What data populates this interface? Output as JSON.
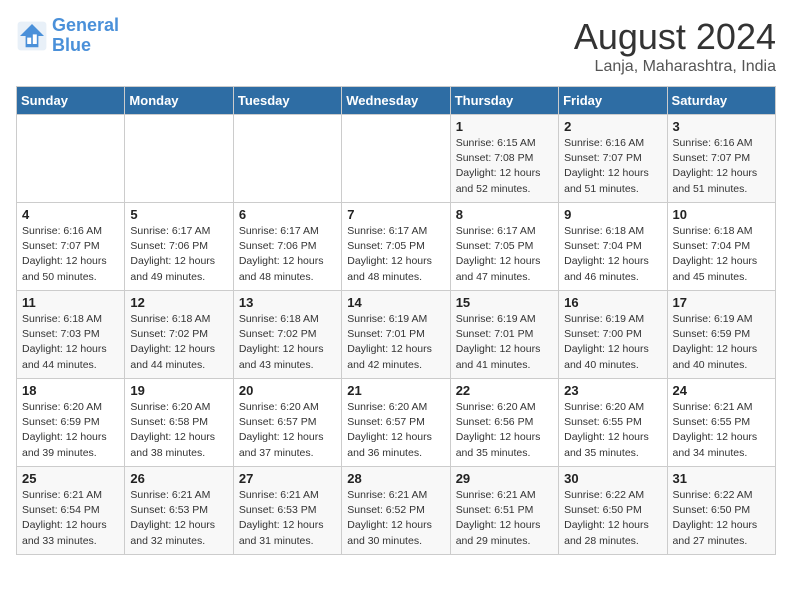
{
  "logo": {
    "line1": "General",
    "line2": "Blue"
  },
  "title": "August 2024",
  "subtitle": "Lanja, Maharashtra, India",
  "days_of_week": [
    "Sunday",
    "Monday",
    "Tuesday",
    "Wednesday",
    "Thursday",
    "Friday",
    "Saturday"
  ],
  "weeks": [
    [
      {
        "day": "",
        "info": ""
      },
      {
        "day": "",
        "info": ""
      },
      {
        "day": "",
        "info": ""
      },
      {
        "day": "",
        "info": ""
      },
      {
        "day": "1",
        "info": "Sunrise: 6:15 AM\nSunset: 7:08 PM\nDaylight: 12 hours\nand 52 minutes."
      },
      {
        "day": "2",
        "info": "Sunrise: 6:16 AM\nSunset: 7:07 PM\nDaylight: 12 hours\nand 51 minutes."
      },
      {
        "day": "3",
        "info": "Sunrise: 6:16 AM\nSunset: 7:07 PM\nDaylight: 12 hours\nand 51 minutes."
      }
    ],
    [
      {
        "day": "4",
        "info": "Sunrise: 6:16 AM\nSunset: 7:07 PM\nDaylight: 12 hours\nand 50 minutes."
      },
      {
        "day": "5",
        "info": "Sunrise: 6:17 AM\nSunset: 7:06 PM\nDaylight: 12 hours\nand 49 minutes."
      },
      {
        "day": "6",
        "info": "Sunrise: 6:17 AM\nSunset: 7:06 PM\nDaylight: 12 hours\nand 48 minutes."
      },
      {
        "day": "7",
        "info": "Sunrise: 6:17 AM\nSunset: 7:05 PM\nDaylight: 12 hours\nand 48 minutes."
      },
      {
        "day": "8",
        "info": "Sunrise: 6:17 AM\nSunset: 7:05 PM\nDaylight: 12 hours\nand 47 minutes."
      },
      {
        "day": "9",
        "info": "Sunrise: 6:18 AM\nSunset: 7:04 PM\nDaylight: 12 hours\nand 46 minutes."
      },
      {
        "day": "10",
        "info": "Sunrise: 6:18 AM\nSunset: 7:04 PM\nDaylight: 12 hours\nand 45 minutes."
      }
    ],
    [
      {
        "day": "11",
        "info": "Sunrise: 6:18 AM\nSunset: 7:03 PM\nDaylight: 12 hours\nand 44 minutes."
      },
      {
        "day": "12",
        "info": "Sunrise: 6:18 AM\nSunset: 7:02 PM\nDaylight: 12 hours\nand 44 minutes."
      },
      {
        "day": "13",
        "info": "Sunrise: 6:18 AM\nSunset: 7:02 PM\nDaylight: 12 hours\nand 43 minutes."
      },
      {
        "day": "14",
        "info": "Sunrise: 6:19 AM\nSunset: 7:01 PM\nDaylight: 12 hours\nand 42 minutes."
      },
      {
        "day": "15",
        "info": "Sunrise: 6:19 AM\nSunset: 7:01 PM\nDaylight: 12 hours\nand 41 minutes."
      },
      {
        "day": "16",
        "info": "Sunrise: 6:19 AM\nSunset: 7:00 PM\nDaylight: 12 hours\nand 40 minutes."
      },
      {
        "day": "17",
        "info": "Sunrise: 6:19 AM\nSunset: 6:59 PM\nDaylight: 12 hours\nand 40 minutes."
      }
    ],
    [
      {
        "day": "18",
        "info": "Sunrise: 6:20 AM\nSunset: 6:59 PM\nDaylight: 12 hours\nand 39 minutes."
      },
      {
        "day": "19",
        "info": "Sunrise: 6:20 AM\nSunset: 6:58 PM\nDaylight: 12 hours\nand 38 minutes."
      },
      {
        "day": "20",
        "info": "Sunrise: 6:20 AM\nSunset: 6:57 PM\nDaylight: 12 hours\nand 37 minutes."
      },
      {
        "day": "21",
        "info": "Sunrise: 6:20 AM\nSunset: 6:57 PM\nDaylight: 12 hours\nand 36 minutes."
      },
      {
        "day": "22",
        "info": "Sunrise: 6:20 AM\nSunset: 6:56 PM\nDaylight: 12 hours\nand 35 minutes."
      },
      {
        "day": "23",
        "info": "Sunrise: 6:20 AM\nSunset: 6:55 PM\nDaylight: 12 hours\nand 35 minutes."
      },
      {
        "day": "24",
        "info": "Sunrise: 6:21 AM\nSunset: 6:55 PM\nDaylight: 12 hours\nand 34 minutes."
      }
    ],
    [
      {
        "day": "25",
        "info": "Sunrise: 6:21 AM\nSunset: 6:54 PM\nDaylight: 12 hours\nand 33 minutes."
      },
      {
        "day": "26",
        "info": "Sunrise: 6:21 AM\nSunset: 6:53 PM\nDaylight: 12 hours\nand 32 minutes."
      },
      {
        "day": "27",
        "info": "Sunrise: 6:21 AM\nSunset: 6:53 PM\nDaylight: 12 hours\nand 31 minutes."
      },
      {
        "day": "28",
        "info": "Sunrise: 6:21 AM\nSunset: 6:52 PM\nDaylight: 12 hours\nand 30 minutes."
      },
      {
        "day": "29",
        "info": "Sunrise: 6:21 AM\nSunset: 6:51 PM\nDaylight: 12 hours\nand 29 minutes."
      },
      {
        "day": "30",
        "info": "Sunrise: 6:22 AM\nSunset: 6:50 PM\nDaylight: 12 hours\nand 28 minutes."
      },
      {
        "day": "31",
        "info": "Sunrise: 6:22 AM\nSunset: 6:50 PM\nDaylight: 12 hours\nand 27 minutes."
      }
    ]
  ]
}
